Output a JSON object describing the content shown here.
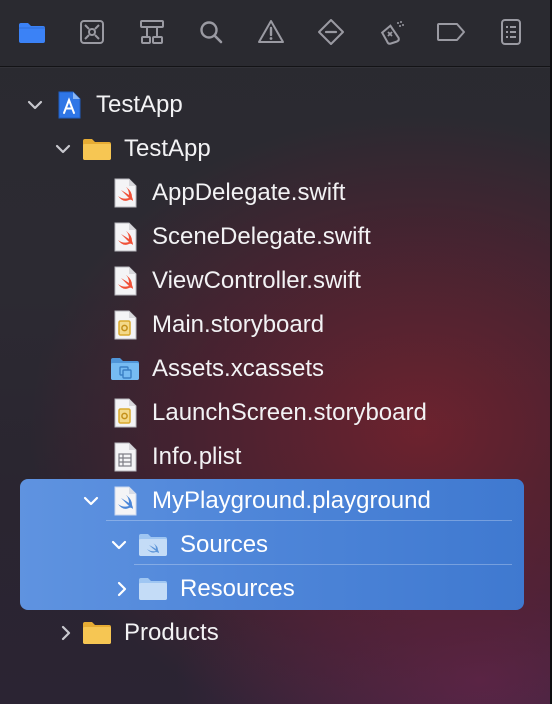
{
  "toolbar": {
    "buttons": [
      {
        "name": "project-navigator",
        "icon": "folder-icon",
        "selected": true
      },
      {
        "name": "source-control-navigator",
        "icon": "source-control-icon"
      },
      {
        "name": "symbol-navigator",
        "icon": "hierarchy-icon"
      },
      {
        "name": "find-navigator",
        "icon": "search-icon"
      },
      {
        "name": "issue-navigator",
        "icon": "warning-icon"
      },
      {
        "name": "test-navigator",
        "icon": "diamond-icon"
      },
      {
        "name": "debug-navigator",
        "icon": "spray-can-icon"
      },
      {
        "name": "breakpoint-navigator",
        "icon": "breakpoint-tag-icon"
      },
      {
        "name": "report-navigator",
        "icon": "report-list-icon"
      }
    ]
  },
  "tree": {
    "project": {
      "label": "TestApp",
      "expanded": true,
      "icon": "xcode-project-icon"
    },
    "group": {
      "label": "TestApp",
      "expanded": true,
      "icon": "folder-icon"
    },
    "files": [
      {
        "label": "AppDelegate.swift",
        "icon": "swift-file-icon"
      },
      {
        "label": "SceneDelegate.swift",
        "icon": "swift-file-icon"
      },
      {
        "label": "ViewController.swift",
        "icon": "swift-file-icon"
      },
      {
        "label": "Main.storyboard",
        "icon": "storyboard-file-icon"
      },
      {
        "label": "Assets.xcassets",
        "icon": "asset-catalog-icon"
      },
      {
        "label": "LaunchScreen.storyboard",
        "icon": "storyboard-file-icon"
      },
      {
        "label": "Info.plist",
        "icon": "plist-file-icon"
      }
    ],
    "playground": {
      "label": "MyPlayground.playground",
      "expanded": true,
      "selected": true,
      "icon": "playground-file-icon"
    },
    "playground_children": [
      {
        "label": "Sources",
        "expanded": true,
        "icon": "sources-folder-icon"
      },
      {
        "label": "Resources",
        "expanded": false,
        "icon": "folder-icon"
      }
    ],
    "products": {
      "label": "Products",
      "expanded": false,
      "icon": "folder-icon"
    }
  },
  "colors": {
    "accent": "#3b82f6",
    "selection": "#4f86d9",
    "folder_yellow": "#f5c451",
    "folder_blue": "#6cb4f0",
    "swift_orange": "#f05138"
  }
}
